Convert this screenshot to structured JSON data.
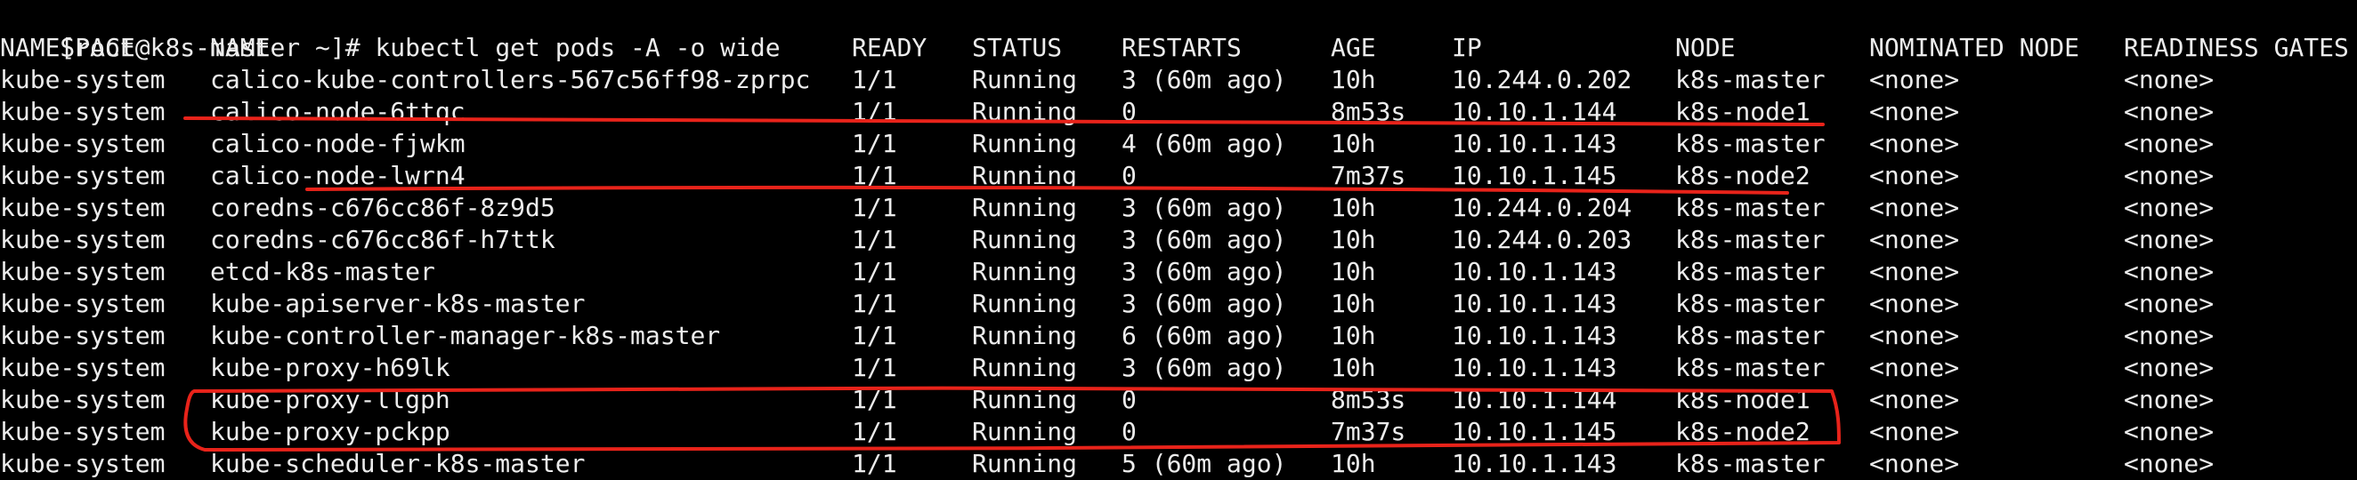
{
  "terminal": {
    "prompt": "[root@k8s-master ~]# ",
    "command": "kubectl get pods -A -o wide",
    "headers": [
      "NAMESPACE",
      "NAME",
      "READY",
      "STATUS",
      "RESTARTS",
      "AGE",
      "IP",
      "NODE",
      "NOMINATED NODE",
      "READINESS GATES"
    ],
    "rows": [
      [
        "kube-system",
        "calico-kube-controllers-567c56ff98-zprpc",
        "1/1",
        "Running",
        "3 (60m ago)",
        "10h",
        "10.244.0.202",
        "k8s-master",
        "<none>",
        "<none>"
      ],
      [
        "kube-system",
        "calico-node-6ttqc",
        "1/1",
        "Running",
        "0",
        "8m53s",
        "10.10.1.144",
        "k8s-node1",
        "<none>",
        "<none>"
      ],
      [
        "kube-system",
        "calico-node-fjwkm",
        "1/1",
        "Running",
        "4 (60m ago)",
        "10h",
        "10.10.1.143",
        "k8s-master",
        "<none>",
        "<none>"
      ],
      [
        "kube-system",
        "calico-node-lwrn4",
        "1/1",
        "Running",
        "0",
        "7m37s",
        "10.10.1.145",
        "k8s-node2",
        "<none>",
        "<none>"
      ],
      [
        "kube-system",
        "coredns-c676cc86f-8z9d5",
        "1/1",
        "Running",
        "3 (60m ago)",
        "10h",
        "10.244.0.204",
        "k8s-master",
        "<none>",
        "<none>"
      ],
      [
        "kube-system",
        "coredns-c676cc86f-h7ttk",
        "1/1",
        "Running",
        "3 (60m ago)",
        "10h",
        "10.244.0.203",
        "k8s-master",
        "<none>",
        "<none>"
      ],
      [
        "kube-system",
        "etcd-k8s-master",
        "1/1",
        "Running",
        "3 (60m ago)",
        "10h",
        "10.10.1.143",
        "k8s-master",
        "<none>",
        "<none>"
      ],
      [
        "kube-system",
        "kube-apiserver-k8s-master",
        "1/1",
        "Running",
        "3 (60m ago)",
        "10h",
        "10.10.1.143",
        "k8s-master",
        "<none>",
        "<none>"
      ],
      [
        "kube-system",
        "kube-controller-manager-k8s-master",
        "1/1",
        "Running",
        "6 (60m ago)",
        "10h",
        "10.10.1.143",
        "k8s-master",
        "<none>",
        "<none>"
      ],
      [
        "kube-system",
        "kube-proxy-h69lk",
        "1/1",
        "Running",
        "3 (60m ago)",
        "10h",
        "10.10.1.143",
        "k8s-master",
        "<none>",
        "<none>"
      ],
      [
        "kube-system",
        "kube-proxy-llgph",
        "1/1",
        "Running",
        "0",
        "8m53s",
        "10.10.1.144",
        "k8s-node1",
        "<none>",
        "<none>"
      ],
      [
        "kube-system",
        "kube-proxy-pckpp",
        "1/1",
        "Running",
        "0",
        "7m37s",
        "10.10.1.145",
        "k8s-node2",
        "<none>",
        "<none>"
      ],
      [
        "kube-system",
        "kube-scheduler-k8s-master",
        "1/1",
        "Running",
        "5 (60m ago)",
        "10h",
        "10.10.1.143",
        "k8s-master",
        "<none>",
        "<none>"
      ]
    ]
  },
  "colors": {
    "background": "#000000",
    "text": "#ececec",
    "annotation": "#e8231a"
  }
}
